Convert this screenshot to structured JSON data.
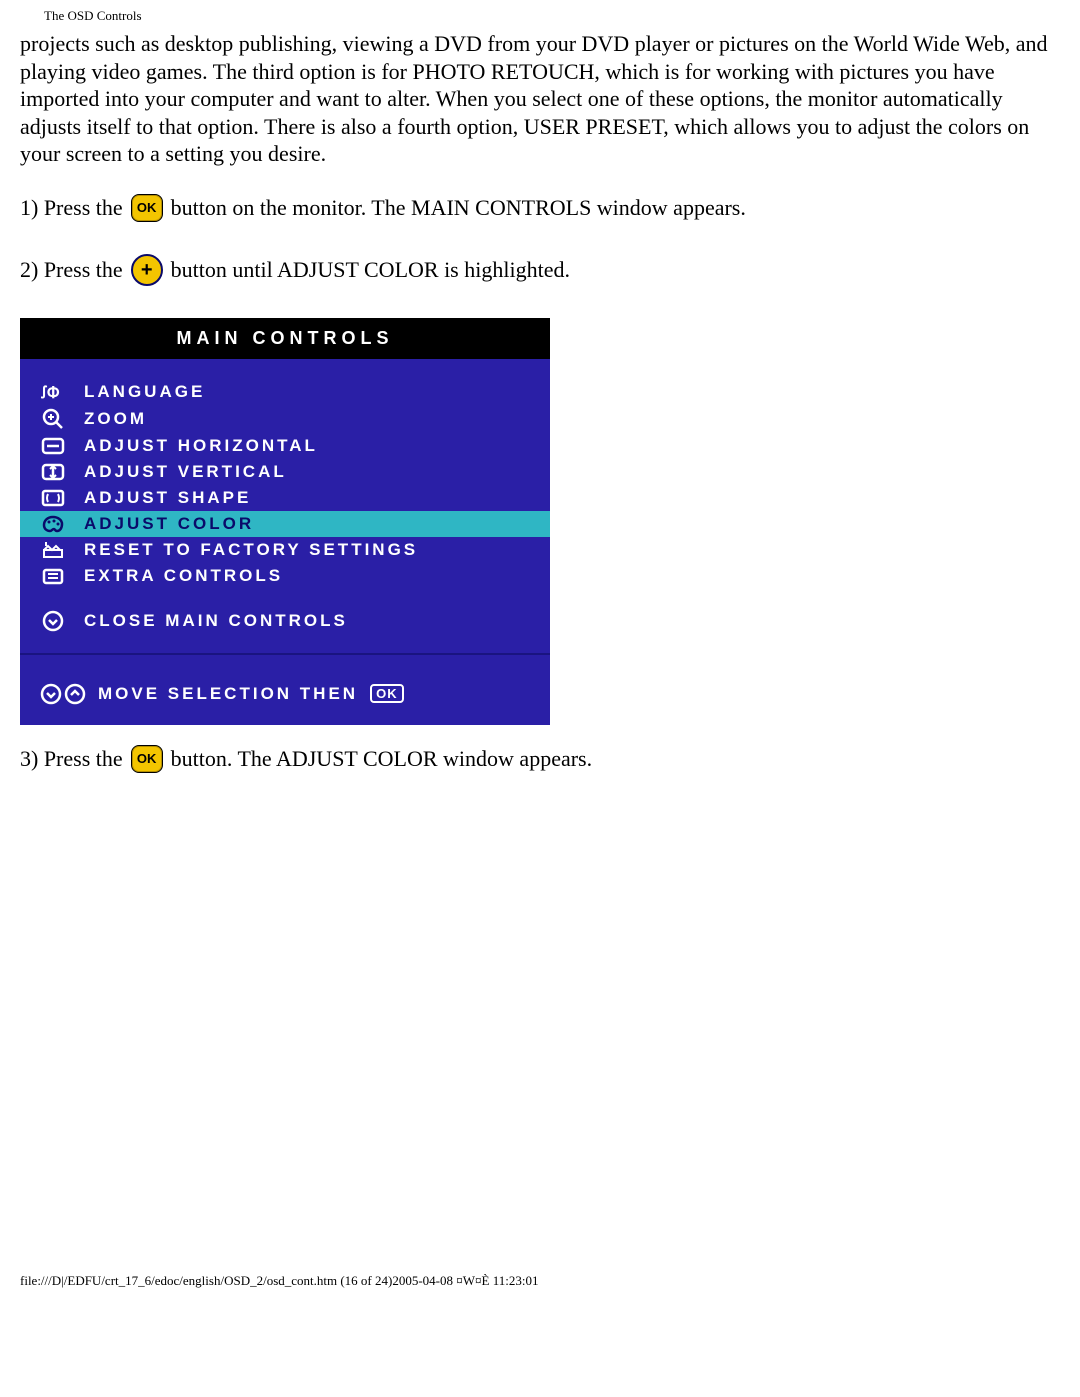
{
  "header": "The OSD Controls",
  "intro": "projects such as desktop publishing, viewing a DVD from your DVD player or pictures on the World Wide Web, and playing video games. The third option is for PHOTO RETOUCH, which is for working with pictures you have imported into your computer and want to alter. When you select one of these options, the monitor automatically adjusts itself to that option. There is also a fourth option, USER PRESET, which allows you to adjust the colors on your screen to a setting you desire.",
  "steps": {
    "s1a": "1) Press the",
    "s1b": "button on the monitor. The MAIN CONTROLS window appears.",
    "s2a": "2) Press the",
    "s2b": "button until ADJUST COLOR is highlighted.",
    "s3a": "3) Press the",
    "s3b": "button. The ADJUST COLOR window appears."
  },
  "buttons": {
    "ok": "OK",
    "plus": "+"
  },
  "osd": {
    "title": "MAIN CONTROLS",
    "items": [
      {
        "label": "LANGUAGE"
      },
      {
        "label": "ZOOM"
      },
      {
        "label": "ADJUST HORIZONTAL"
      },
      {
        "label": "ADJUST VERTICAL"
      },
      {
        "label": "ADJUST SHAPE"
      },
      {
        "label": "ADJUST COLOR"
      },
      {
        "label": "RESET TO FACTORY SETTINGS"
      },
      {
        "label": "EXTRA CONTROLS"
      }
    ],
    "close": "CLOSE MAIN CONTROLS",
    "footer": "MOVE SELECTION THEN",
    "footer_ok": "OK"
  },
  "footer": "file:///D|/EDFU/crt_17_6/edoc/english/OSD_2/osd_cont.htm (16 of 24)2005-04-08 ¤W¤È 11:23:01"
}
